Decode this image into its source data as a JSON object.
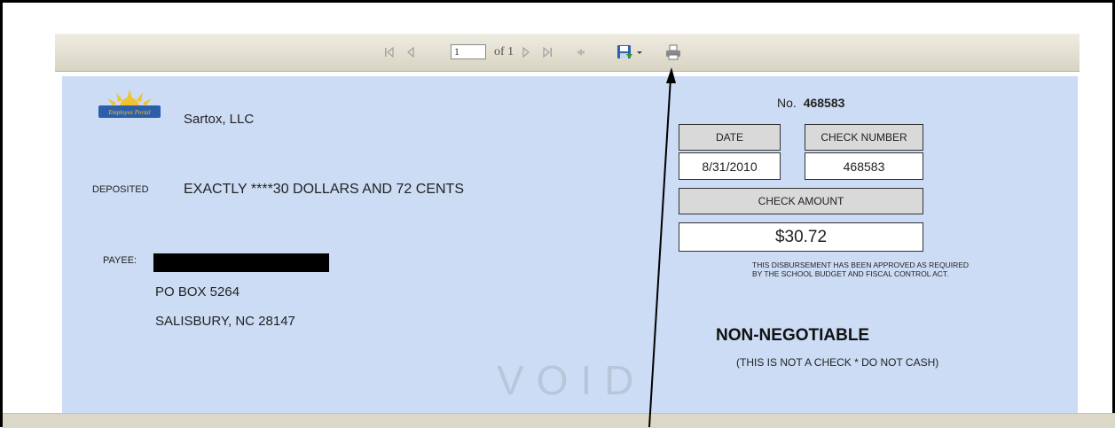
{
  "toolbar": {
    "page_input_value": "1",
    "page_of_label": "of 1",
    "icons": [
      "first-page-icon",
      "prev-page-icon",
      "next-page-icon",
      "last-page-icon",
      "back-icon",
      "save-export-icon",
      "dropdown-caret-icon",
      "print-icon"
    ]
  },
  "check": {
    "company_name": "Sartox, LLC",
    "deposited_label": "DEPOSITED",
    "amount_words": "EXACTLY ****30 DOLLARS AND 72 CENTS",
    "payee_label": "PAYEE:",
    "address_line1": "PO BOX 5264",
    "address_line2": "SALISBURY, NC 28147",
    "void_watermark": "VOID",
    "number_label": "No.",
    "number_value": "468583",
    "date_header": "DATE",
    "check_number_header": "CHECK NUMBER",
    "date_value": "8/31/2010",
    "check_number_value": "468583",
    "check_amount_header": "CHECK AMOUNT",
    "check_amount_value": "$30.72",
    "approval_line1": "THIS DISBURSEMENT HAS BEEN APPROVED AS REQUIRED",
    "approval_line2": "BY THE SCHOOL BUDGET AND FISCAL CONTROL ACT.",
    "non_negotiable": "NON-NEGOTIABLE",
    "not_a_check": "(THIS IS NOT A CHECK * DO NOT CASH)"
  },
  "colors": {
    "check_background": "#ccdcf5",
    "toolbar_background": "#e4e0d0",
    "save_icon_blue": "#2f5fb3"
  }
}
